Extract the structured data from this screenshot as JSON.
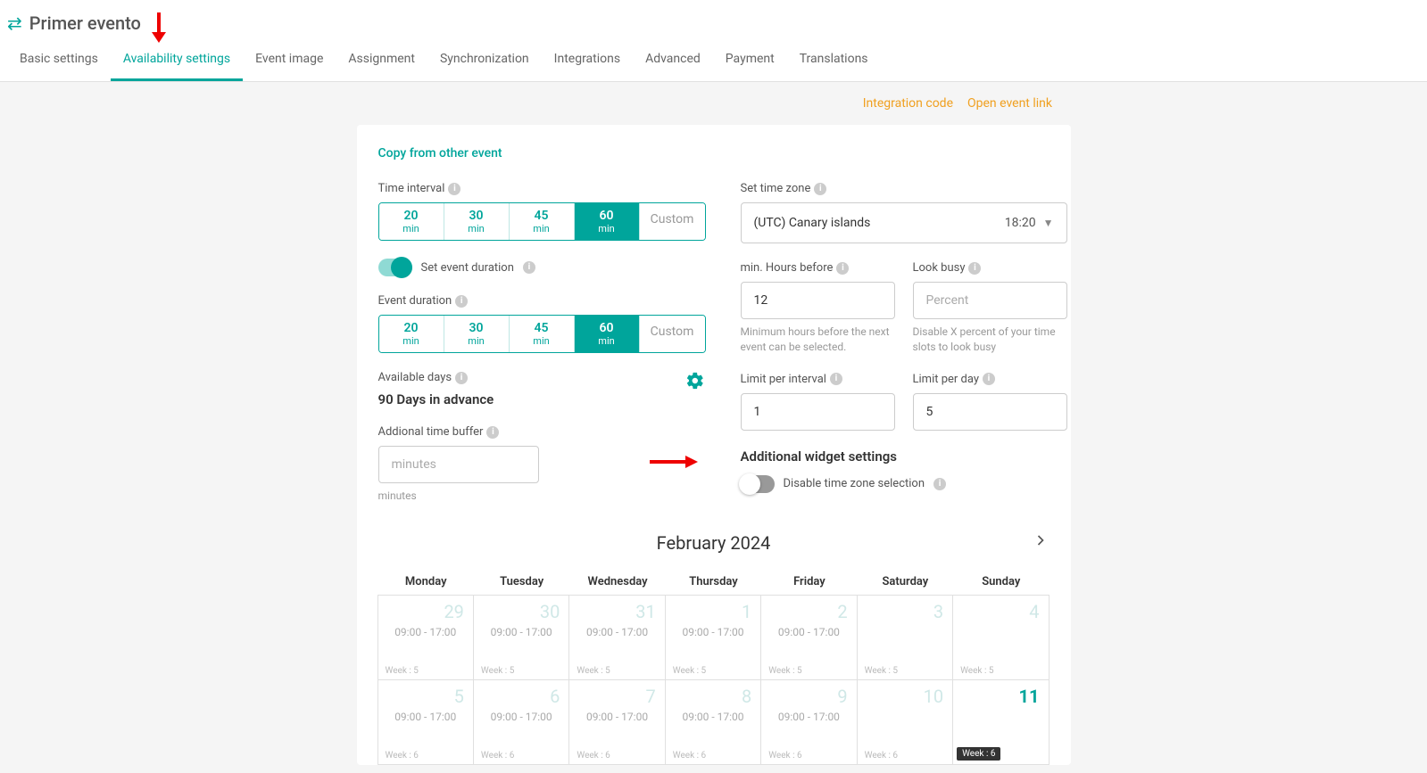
{
  "header": {
    "title": "Primer evento"
  },
  "tabs": [
    {
      "label": "Basic settings",
      "active": false
    },
    {
      "label": "Availability settings",
      "active": true
    },
    {
      "label": "Event image",
      "active": false
    },
    {
      "label": "Assignment",
      "active": false
    },
    {
      "label": "Synchronization",
      "active": false
    },
    {
      "label": "Integrations",
      "active": false
    },
    {
      "label": "Advanced",
      "active": false
    },
    {
      "label": "Payment",
      "active": false
    },
    {
      "label": "Translations",
      "active": false
    }
  ],
  "links": {
    "integration": "Integration code",
    "open_event": "Open event link"
  },
  "card": {
    "copy_link": "Copy from other event",
    "time_interval_label": "Time interval",
    "intervals": [
      {
        "num": "20",
        "unit": "min"
      },
      {
        "num": "30",
        "unit": "min"
      },
      {
        "num": "45",
        "unit": "min"
      },
      {
        "num": "60",
        "unit": "min",
        "active": true
      }
    ],
    "custom_label": "Custom",
    "set_duration_label": "Set event duration",
    "event_duration_label": "Event duration",
    "durations": [
      {
        "num": "20",
        "unit": "min"
      },
      {
        "num": "30",
        "unit": "min"
      },
      {
        "num": "45",
        "unit": "min"
      },
      {
        "num": "60",
        "unit": "min",
        "active": true
      }
    ],
    "available_days_label": "Available days",
    "available_days_value": "90 Days in advance",
    "buffer_label": "Addional time buffer",
    "buffer_placeholder": "minutes",
    "buffer_help": "minutes",
    "timezone_label": "Set time zone",
    "timezone_value": "(UTC) Canary islands",
    "timezone_time": "18:20",
    "min_hours_label": "min. Hours before",
    "min_hours_value": "12",
    "min_hours_help": "Minimum hours before the next event can be selected.",
    "look_busy_label": "Look busy",
    "look_busy_placeholder": "Percent",
    "look_busy_help": "Disable X percent of your time slots to look busy",
    "limit_interval_label": "Limit per interval",
    "limit_interval_value": "1",
    "limit_day_label": "Limit per day",
    "limit_day_value": "5",
    "widget_heading": "Additional widget settings",
    "disable_tz_label": "Disable time zone selection"
  },
  "calendar": {
    "title": "February 2024",
    "dow": [
      "Monday",
      "Tuesday",
      "Wednesday",
      "Thursday",
      "Friday",
      "Saturday",
      "Sunday"
    ],
    "cells": [
      {
        "date": "29",
        "muted": true,
        "time": "09:00 - 17:00",
        "week": "Week : 5"
      },
      {
        "date": "30",
        "muted": true,
        "time": "09:00 - 17:00",
        "week": "Week : 5"
      },
      {
        "date": "31",
        "muted": true,
        "time": "09:00 - 17:00",
        "week": "Week : 5"
      },
      {
        "date": "1",
        "muted": true,
        "time": "09:00 - 17:00",
        "week": "Week : 5"
      },
      {
        "date": "2",
        "muted": true,
        "time": "09:00 - 17:00",
        "week": "Week : 5"
      },
      {
        "date": "3",
        "muted": true,
        "time": "",
        "week": "Week : 5"
      },
      {
        "date": "4",
        "muted": true,
        "time": "",
        "week": "Week : 5"
      },
      {
        "date": "5",
        "muted": true,
        "time": "09:00 - 17:00",
        "week": "Week : 6"
      },
      {
        "date": "6",
        "muted": true,
        "time": "09:00 - 17:00",
        "week": "Week : 6"
      },
      {
        "date": "7",
        "muted": true,
        "time": "09:00 - 17:00",
        "week": "Week : 6"
      },
      {
        "date": "8",
        "muted": true,
        "time": "09:00 - 17:00",
        "week": "Week : 6"
      },
      {
        "date": "9",
        "muted": true,
        "time": "09:00 - 17:00",
        "week": "Week : 6"
      },
      {
        "date": "10",
        "muted": true,
        "time": "",
        "week": "Week : 6"
      },
      {
        "date": "11",
        "current": true,
        "time": "",
        "week": "Week : 6"
      }
    ]
  }
}
